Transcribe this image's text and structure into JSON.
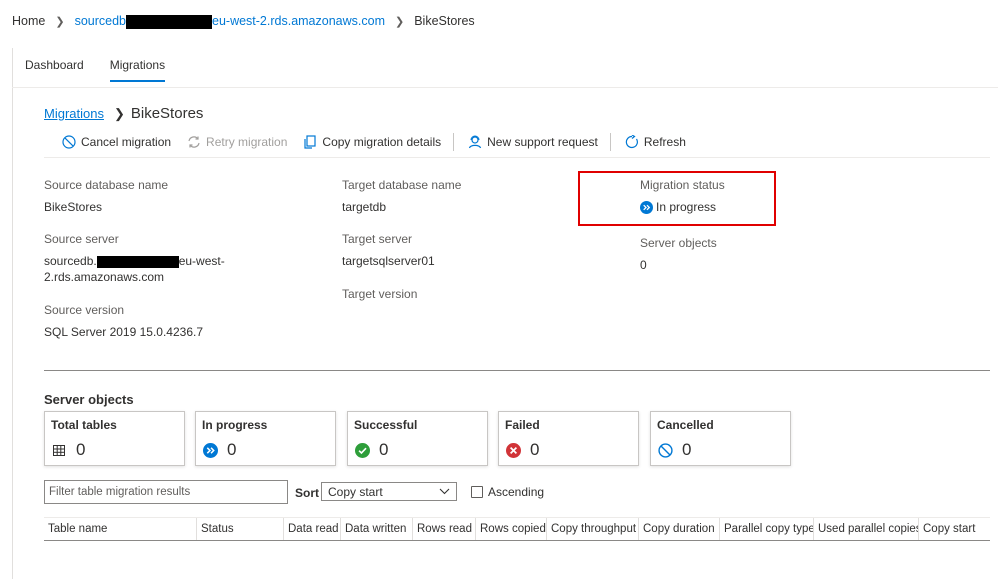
{
  "breadcrumb": {
    "home": "Home",
    "server_prefix": "sourcedb",
    "server_suffix": "eu-west-2.rds.amazonaws.com",
    "current": "BikeStores"
  },
  "tabs": [
    {
      "label": "Dashboard",
      "active": false
    },
    {
      "label": "Migrations",
      "active": true
    }
  ],
  "heading": {
    "parent_link": "Migrations",
    "title": "BikeStores"
  },
  "toolbar": {
    "cancel": "Cancel migration",
    "retry": "Retry migration",
    "copy": "Copy migration details",
    "support": "New support request",
    "refresh": "Refresh"
  },
  "details": {
    "source_db_label": "Source database name",
    "source_db_value": "BikeStores",
    "source_server_label": "Source server",
    "source_server_prefix": "sourcedb.",
    "source_server_suffix": "eu-west-",
    "source_server_line2": "2.rds.amazonaws.com",
    "source_version_label": "Source version",
    "source_version_value": "SQL Server 2019 15.0.4236.7",
    "target_db_label": "Target database name",
    "target_db_value": "targetdb",
    "target_server_label": "Target server",
    "target_server_value": "targetsqlserver01",
    "target_version_label": "Target version",
    "migration_status_label": "Migration status",
    "migration_status_value": "In progress",
    "server_objects_label": "Server objects",
    "server_objects_value": "0"
  },
  "server_objects": {
    "title": "Server objects",
    "cards": [
      {
        "title": "Total tables",
        "value": "0",
        "icon": "table-grid-icon"
      },
      {
        "title": "In progress",
        "value": "0",
        "icon": "in-progress-icon"
      },
      {
        "title": "Successful",
        "value": "0",
        "icon": "check-circle-icon"
      },
      {
        "title": "Failed",
        "value": "0",
        "icon": "error-circle-icon"
      },
      {
        "title": "Cancelled",
        "value": "0",
        "icon": "cancel-circle-icon"
      }
    ]
  },
  "filter": {
    "placeholder": "Filter table migration results",
    "sort_label": "Sort",
    "sort_value": "Copy start",
    "ascending_label": "Ascending"
  },
  "table": {
    "columns": [
      "Table name",
      "Status",
      "Data read",
      "Data written",
      "Rows read",
      "Rows copied",
      "Copy throughput",
      "Copy duration",
      "Parallel copy type",
      "Used parallel copies",
      "Copy start"
    ]
  },
  "colors": {
    "accent": "#0078d4",
    "highlight_box": "#e00000",
    "success": "#2e9e3a",
    "error": "#d13438"
  }
}
